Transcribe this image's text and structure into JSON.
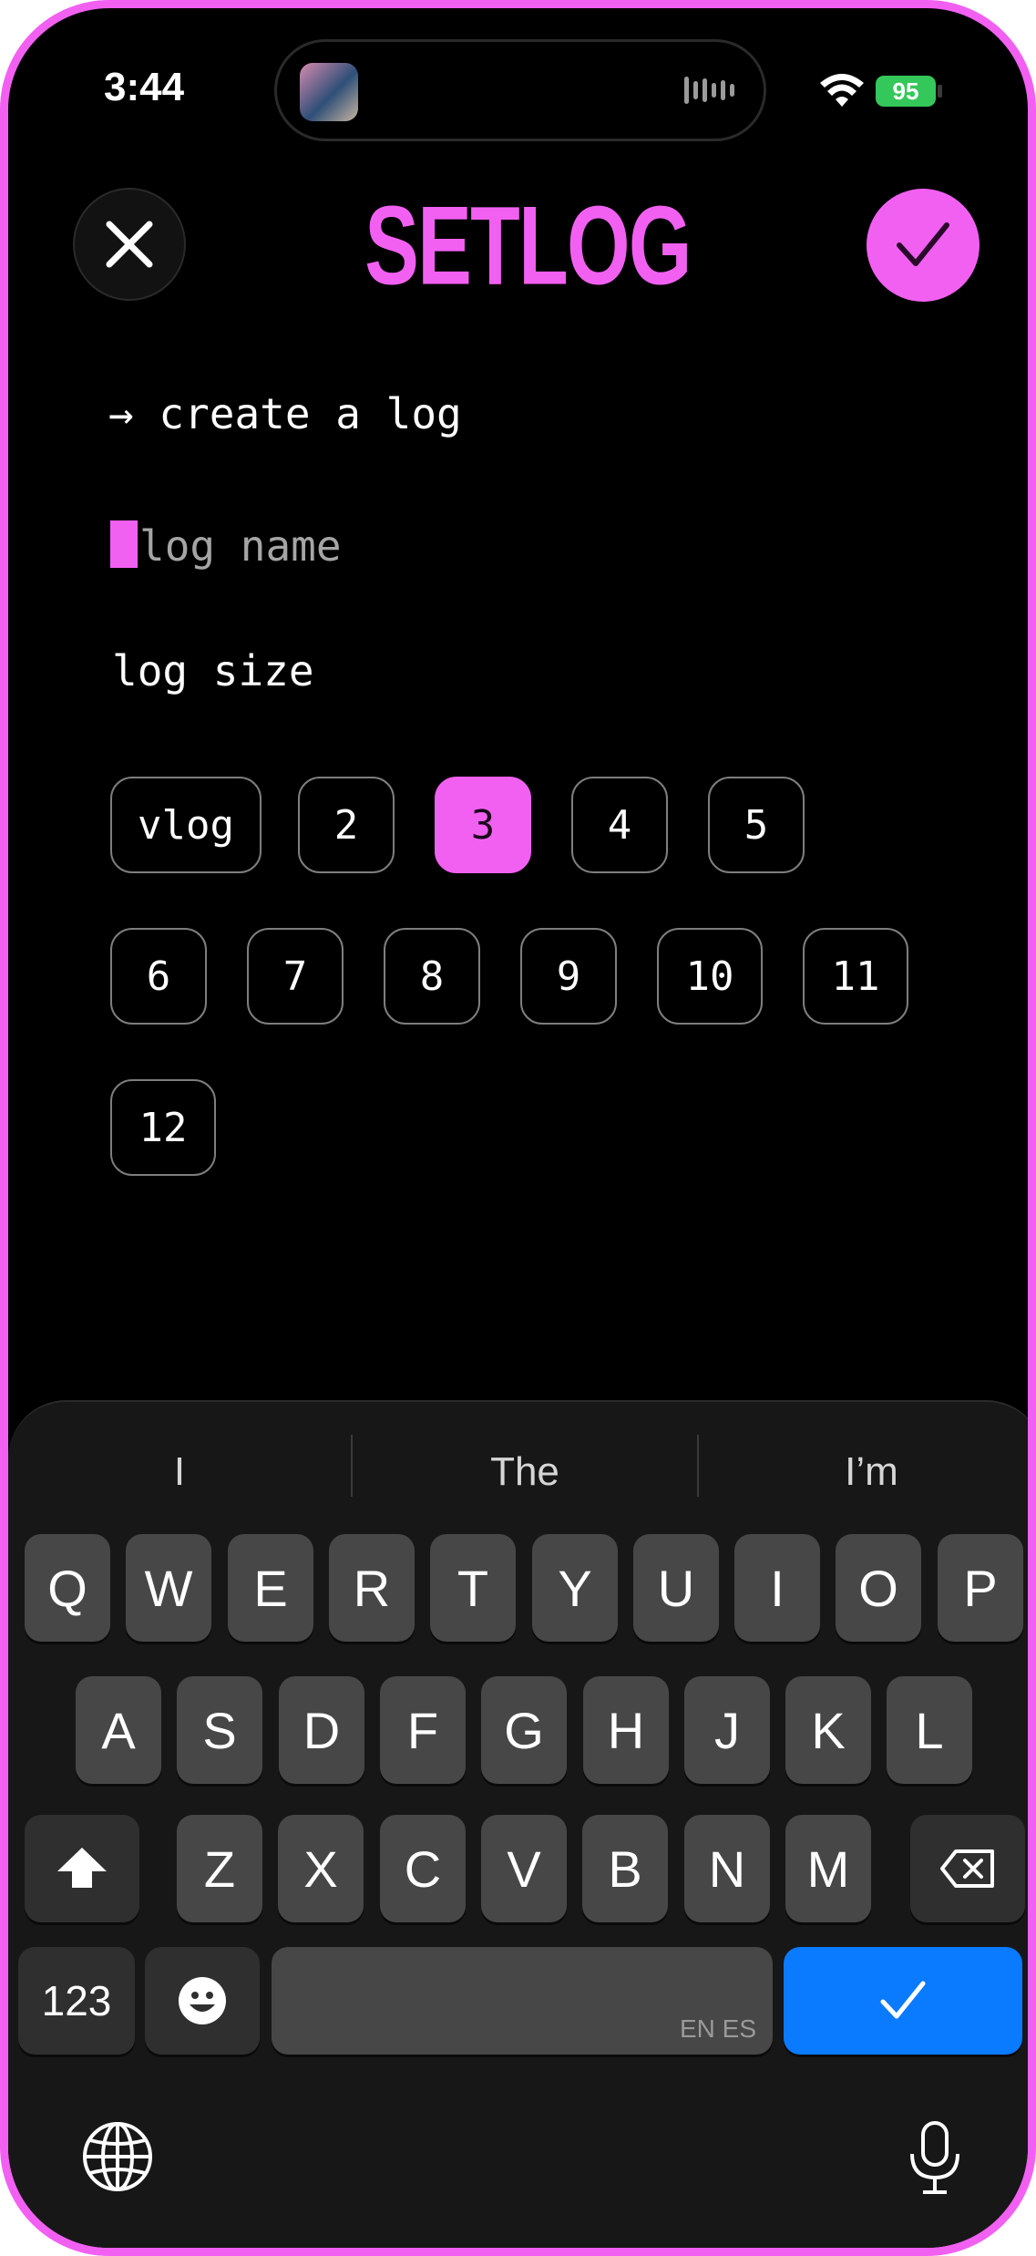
{
  "status_bar": {
    "time": "3:44",
    "battery_level": "95",
    "battery_color": "#34c759"
  },
  "header": {
    "title": "SETLOG",
    "accent": "#f260f2"
  },
  "form": {
    "heading": "→ create a log",
    "name_placeholder": "log name",
    "size_label": "log size",
    "sizes": [
      "vlog",
      "2",
      "3",
      "4",
      "5",
      "6",
      "7",
      "8",
      "9",
      "10",
      "11",
      "12"
    ],
    "selected_size": "3"
  },
  "keyboard": {
    "suggestions": [
      "I",
      "The",
      "I’m"
    ],
    "row1": [
      "Q",
      "W",
      "E",
      "R",
      "T",
      "Y",
      "U",
      "I",
      "O",
      "P"
    ],
    "row2": [
      "A",
      "S",
      "D",
      "F",
      "G",
      "H",
      "J",
      "K",
      "L"
    ],
    "row3": [
      "Z",
      "X",
      "C",
      "V",
      "B",
      "N",
      "M"
    ],
    "numbers_key": "123",
    "space_languages": "EN ES",
    "return_color": "#0a7aff"
  }
}
